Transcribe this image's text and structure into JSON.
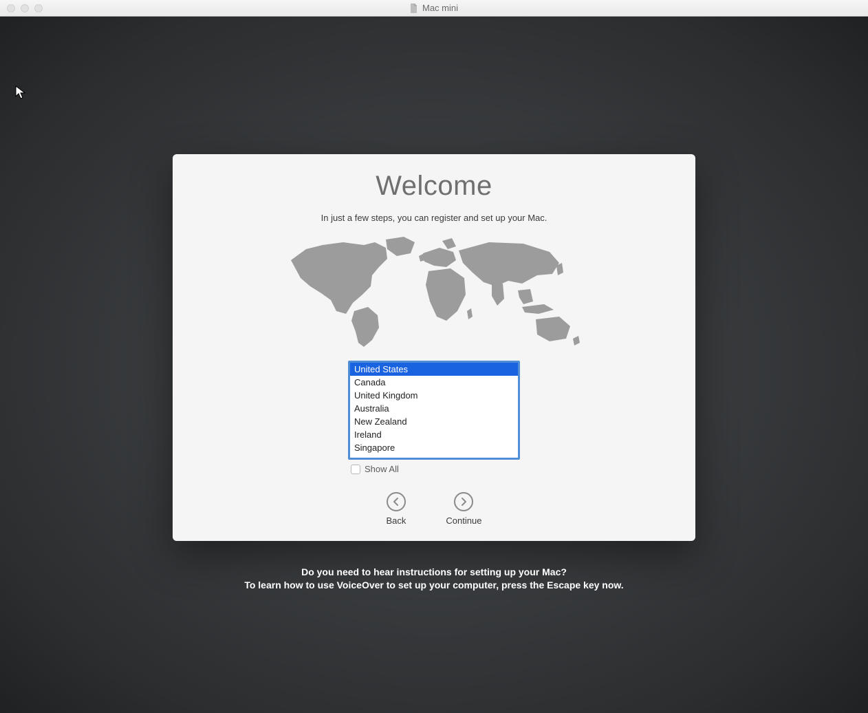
{
  "window": {
    "title": "Mac mini"
  },
  "panel": {
    "heading": "Welcome",
    "subtitle": "In just a few steps, you can register and set up your Mac."
  },
  "countries": {
    "items": [
      "United States",
      "Canada",
      "United Kingdom",
      "Australia",
      "New Zealand",
      "Ireland",
      "Singapore"
    ],
    "selected_index": 0,
    "show_all_label": "Show All",
    "show_all_checked": false
  },
  "nav": {
    "back_label": "Back",
    "continue_label": "Continue"
  },
  "hint": {
    "line1": "Do you need to hear instructions for setting up your Mac?",
    "line2": "To learn how to use VoiceOver to set up your computer, press the Escape key now."
  },
  "colors": {
    "selection": "#1a63e0",
    "list_border": "#4f8ed6",
    "panel_bg": "#f5f5f6"
  }
}
